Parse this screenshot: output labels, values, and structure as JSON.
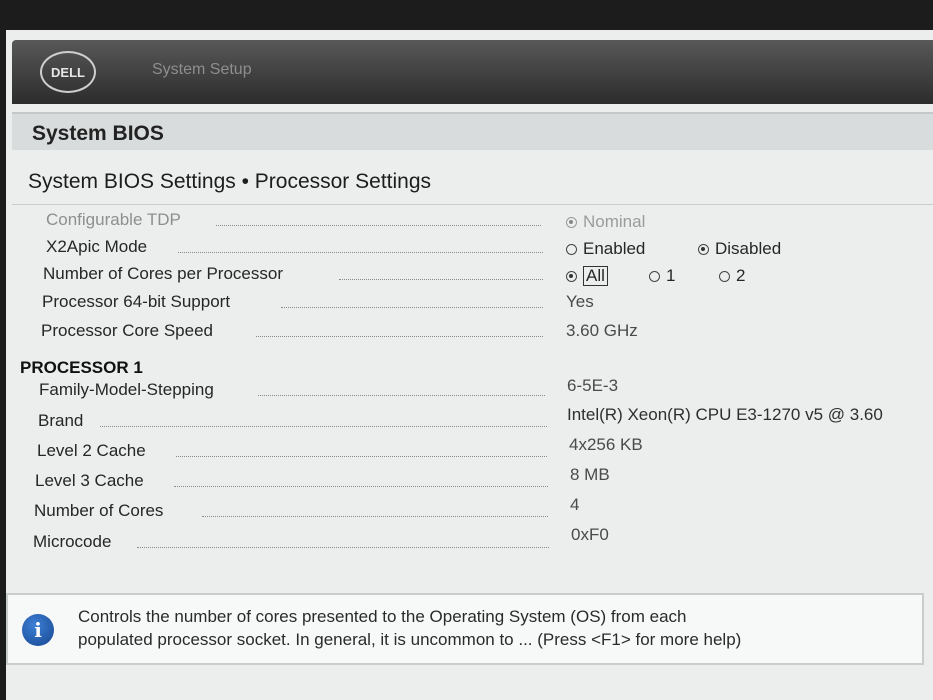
{
  "header": {
    "logo_text": "DELL",
    "app_title": "System Setup"
  },
  "page": {
    "title": "System BIOS",
    "breadcrumb": "System BIOS Settings • Processor Settings"
  },
  "settings": {
    "configurable_tdp": {
      "label": "Configurable TDP",
      "options": [
        "Nominal"
      ],
      "selected": "Nominal",
      "disabled": true
    },
    "x2apic_mode": {
      "label": "X2Apic Mode",
      "options": [
        "Enabled",
        "Disabled"
      ],
      "selected": "Disabled"
    },
    "cores_per_processor": {
      "label": "Number of Cores per Processor",
      "options": [
        "All",
        "1",
        "2"
      ],
      "selected": "All"
    },
    "processor_64bit": {
      "label": "Processor 64-bit Support",
      "value": "Yes"
    },
    "processor_core_speed": {
      "label": "Processor Core Speed",
      "value": "3.60 GHz"
    }
  },
  "processor1": {
    "heading": "PROCESSOR 1",
    "family_model_stepping": {
      "label": "Family-Model-Stepping",
      "value": "6-5E-3"
    },
    "brand": {
      "label": "Brand",
      "value": "Intel(R) Xeon(R) CPU E3-1270 v5 @ 3.60"
    },
    "l2_cache": {
      "label": "Level 2 Cache",
      "value": "4x256 KB"
    },
    "l3_cache": {
      "label": "Level 3 Cache",
      "value": "8 MB"
    },
    "num_cores": {
      "label": "Number of Cores",
      "value": "4"
    },
    "microcode": {
      "label": "Microcode",
      "value": "0xF0"
    }
  },
  "help": {
    "icon": "info-icon",
    "text_line1": "Controls the number of cores presented to the Operating System (OS) from each",
    "text_line2": "populated processor socket. In general, it is uncommon to ... (Press <F1> for more help)"
  }
}
